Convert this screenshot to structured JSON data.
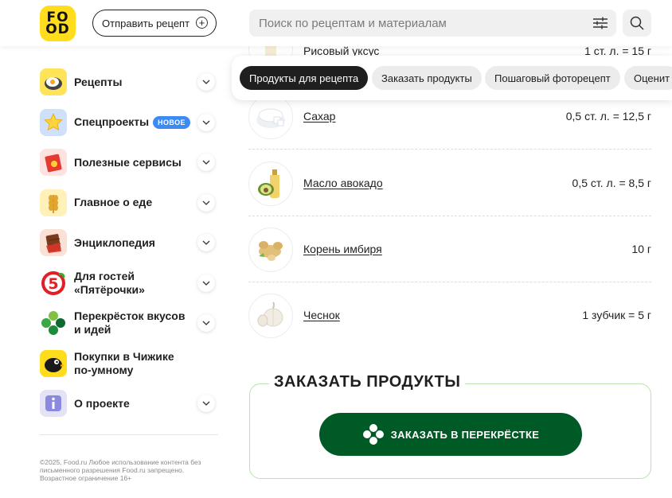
{
  "header": {
    "logo_top": "FO",
    "logo_bottom": "OD",
    "send_recipe_label": "Отправить рецепт",
    "search_placeholder": "Поиск по рецептам и материалам"
  },
  "sidebar": {
    "items": [
      {
        "label": "Рецепты",
        "icon": "fried-egg-icon"
      },
      {
        "label": "Спецпроекты",
        "badge": "НОВОЕ",
        "icon": "star-icon"
      },
      {
        "label": "Полезные сервисы",
        "icon": "gift-box-icon"
      },
      {
        "label": "Главное о еде",
        "icon": "wheat-icon"
      },
      {
        "label": "Энциклопедия",
        "icon": "chocolate-icon"
      },
      {
        "label": "Для гостей «Пятёрочки»",
        "icon": "pyaterochka-logo-icon"
      },
      {
        "label": "Перекрёсток вкусов и идей",
        "icon": "perekrestok-logo-icon"
      },
      {
        "label": "Покупки в Чижике по-умному",
        "icon": "chizhik-bird-icon"
      },
      {
        "label": "О проекте",
        "icon": "info-icon"
      }
    ],
    "footer": "©2025, Food.ru Любое использование контента без письменного разрешения Food.ru запрещено. Возрастное ограничение 16+"
  },
  "tabs": [
    {
      "label": "Продукты для рецепта",
      "active": true
    },
    {
      "label": "Заказать продукты",
      "active": false
    },
    {
      "label": "Пошаговый фоторецепт",
      "active": false
    },
    {
      "label": "Оценит",
      "active": false
    }
  ],
  "ingredients": [
    {
      "name": "Рисовый уксус",
      "amount": "1 ст. л. = 15 г",
      "icon": "vinegar-bottle-icon"
    },
    {
      "name": "Сахар",
      "amount": "0,5 ст. л. = 12,5 г",
      "icon": "sugar-bowl-icon"
    },
    {
      "name": "Масло авокадо",
      "amount": "0,5 ст. л. = 8,5 г",
      "icon": "avocado-oil-icon"
    },
    {
      "name": "Корень имбиря",
      "amount": "10 г",
      "icon": "ginger-root-icon"
    },
    {
      "name": "Чеснок",
      "amount": "1 зубчик = 5 г",
      "icon": "garlic-icon"
    }
  ],
  "order": {
    "title": "ЗАКАЗАТЬ ПРОДУКТЫ",
    "button_label": "ЗАКАЗАТЬ В ПЕРЕКРЁСТКЕ"
  },
  "colors": {
    "brand_yellow": "#ffdd1c",
    "active_tab": "#1f1f1f",
    "order_green": "#005a26",
    "badge_blue": "#3d8bf2",
    "order_border": "#b9e3ae"
  }
}
